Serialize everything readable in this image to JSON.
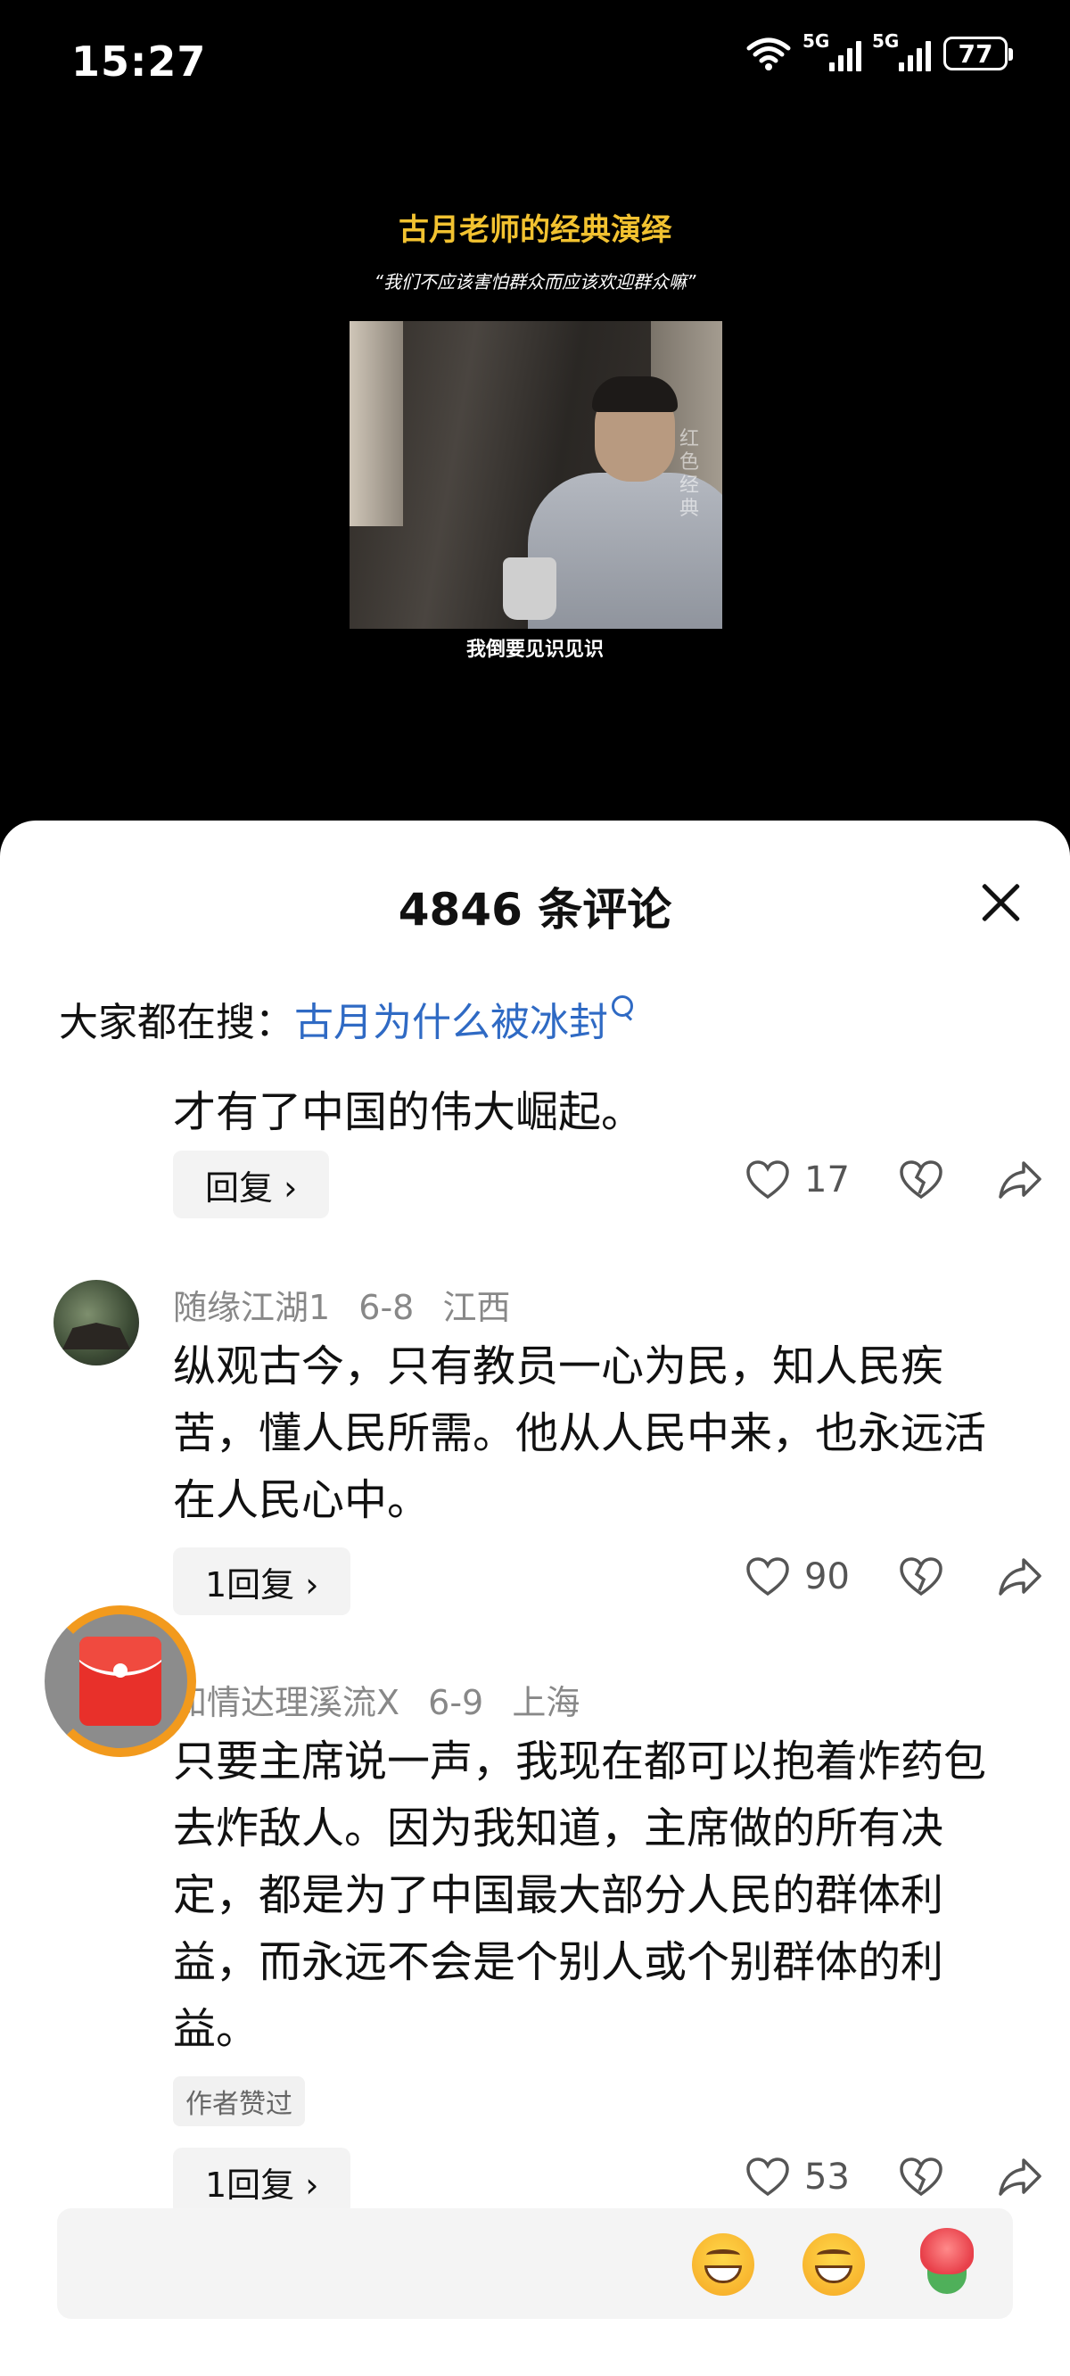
{
  "status_bar": {
    "time": "15:27",
    "network_1": "5G",
    "network_2": "5G",
    "battery": "77"
  },
  "video": {
    "title": "古月老师的经典演绎",
    "subtitle": "“我们不应该害怕群众而应该欢迎群众嘛”",
    "watermark": "红色经典",
    "caption": "我倒要见识见识"
  },
  "comments_panel": {
    "title": "4846 条评论",
    "search_prefix": "大家都在搜：",
    "search_keyword": "古月为什么被冰封"
  },
  "comments": [
    {
      "text": "才有了中国的伟大崛起。",
      "reply_label": "回复 ›",
      "likes": "17"
    },
    {
      "user": "随缘江湖1",
      "date": "6-8",
      "location": "江西",
      "text": "纵观古今，只有教员一心为民，知人民疾苦，懂人民所需。他从人民中来，也永远活在人民心中。",
      "reply_label": "1回复 ›",
      "likes": "90"
    },
    {
      "user": "知情达理溪流X",
      "date": "6-9",
      "location": "上海",
      "text": "只要主席说一声，我现在都可以抱着炸药包去炸敌人。因为我知道，主席做的所有决定，都是为了中国最大部分人民的群体利益，而永远不会是个别人或个别群体的利益。",
      "tag": "作者赞过",
      "reply_label": "1回复 ›",
      "likes": "53"
    }
  ],
  "input_bar": {
    "emojis": [
      "laughing-emoji",
      "grinning-emoji",
      "rose-emoji"
    ]
  },
  "colors": {
    "accent_blue": "#2f6ac4",
    "title_gold": "#f2c230",
    "redpacket_ring": "#f29a1d"
  }
}
